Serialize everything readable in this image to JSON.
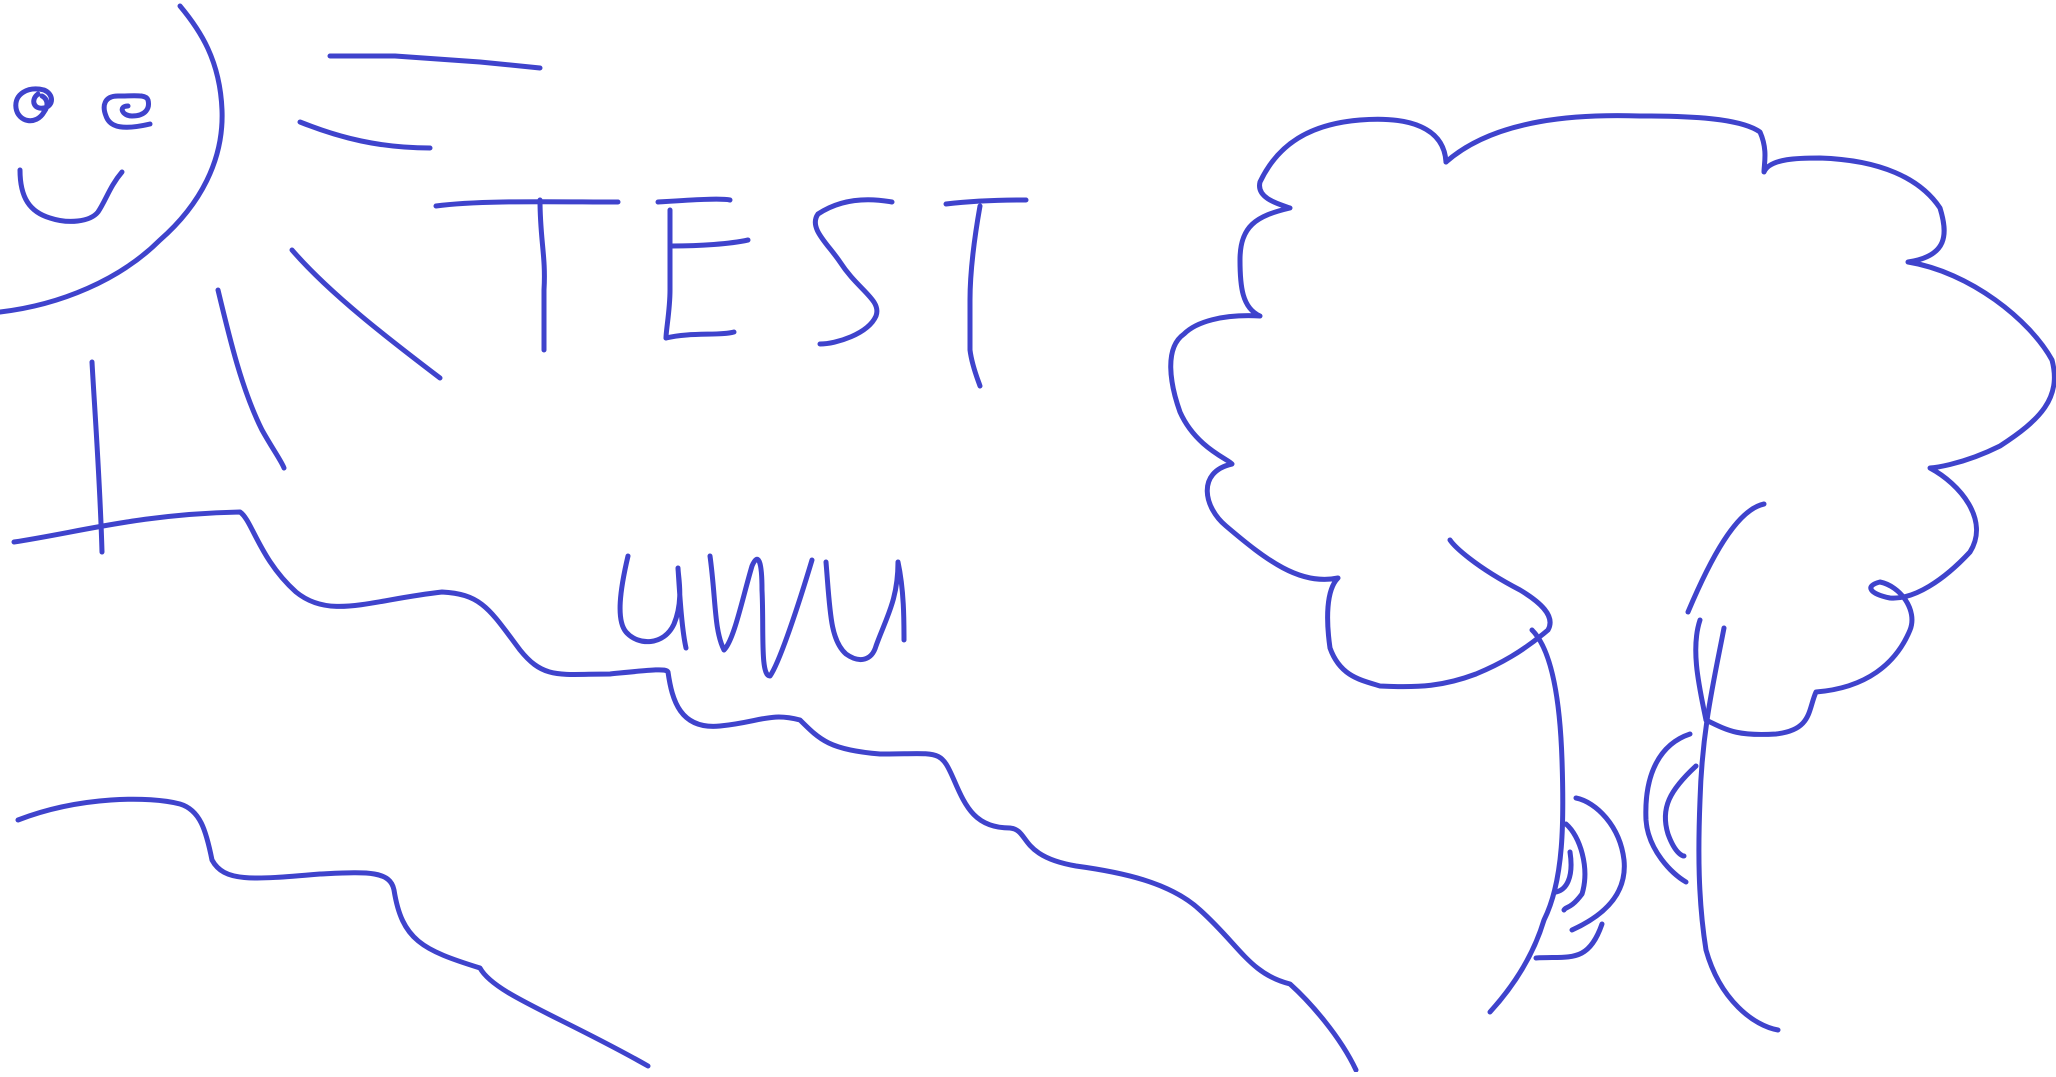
{
  "drawing": {
    "ink_color": "#3f43cc",
    "background_color": "#ffffff",
    "handwritten_words": [
      "TEST",
      "uwu"
    ]
  }
}
